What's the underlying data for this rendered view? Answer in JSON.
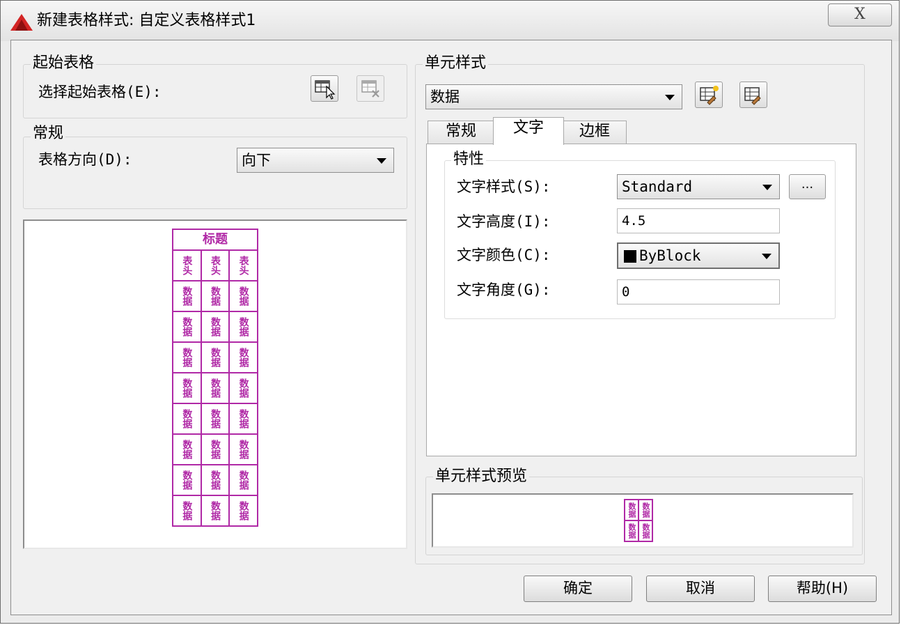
{
  "window": {
    "title": "新建表格样式: 自定义表格样式1",
    "close_glyph": "X"
  },
  "start_table": {
    "group_label": "起始表格",
    "select_label": "选择起始表格(E):",
    "select_icon": "table-cursor-icon",
    "delete_icon": "table-delete-icon"
  },
  "general": {
    "group_label": "常规",
    "direction_label": "表格方向(D):",
    "direction_value": "向下"
  },
  "table_preview": {
    "title_text": "标题",
    "header_cells": [
      "表头",
      "表头",
      "表头"
    ],
    "data_cell": "数据",
    "data_row_count": 8
  },
  "cell_style": {
    "group_label": "单元样式",
    "selected": "数据",
    "new_icon": "new-cell-style-icon",
    "manage_icon": "manage-cell-styles-icon",
    "tabs": [
      {
        "label": "常规",
        "active": false
      },
      {
        "label": "文字",
        "active": true
      },
      {
        "label": "边框",
        "active": false
      }
    ]
  },
  "properties": {
    "group_label": "特性",
    "text_style_label": "文字样式(S):",
    "text_style_value": "Standard",
    "browse_label": "...",
    "text_height_label": "文字高度(I):",
    "text_height_value": "4.5",
    "text_color_label": "文字颜色(C):",
    "text_color_value": "ByBlock",
    "text_color_swatch": "#000000",
    "text_angle_label": "文字角度(G):",
    "text_angle_value": "0"
  },
  "cell_preview": {
    "group_label": "单元样式预览",
    "cell_text": "数据"
  },
  "buttons": {
    "ok": "确定",
    "cancel": "取消",
    "help": "帮助(H)"
  },
  "colors": {
    "preview_magenta": "#b029a6",
    "app_icon_red": "#d32424"
  }
}
